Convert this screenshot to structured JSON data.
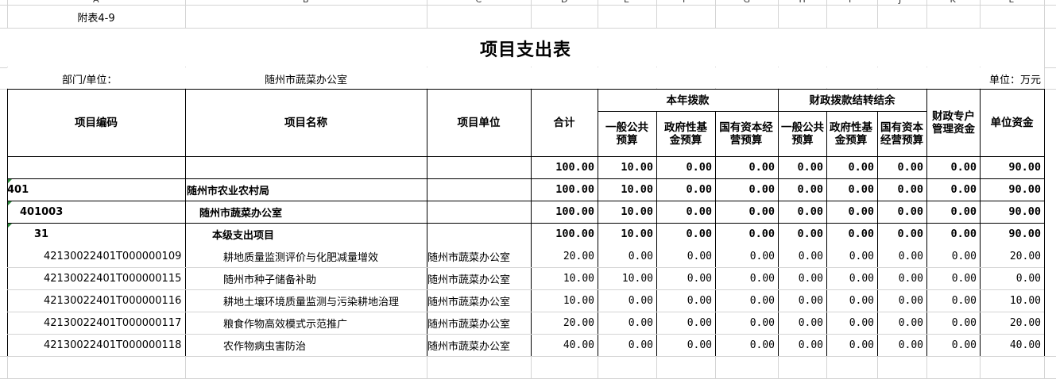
{
  "columns": [
    "A",
    "B",
    "C",
    "D",
    "E",
    "F",
    "G",
    "H",
    "I",
    "J",
    "K",
    "L"
  ],
  "sheet": {
    "attachment": "附表4-9",
    "title": "项目支出表",
    "dept_label": "部门/单位：",
    "dept_value": "随州市蔬菜办公室",
    "unit": "单位：万元"
  },
  "header": {
    "code": "项目编码",
    "name": "项目名称",
    "unit": "项目单位",
    "total": "合计",
    "current_year": "本年拨款",
    "general_budget": "一般公共预算",
    "gov_fund": "政府性基金预算",
    "state_capital": "国有资本经营预算",
    "carryover": "财政拨款结转结余",
    "co_general": "一般公共预算",
    "co_gov_fund": "政府性基金预算",
    "co_state_capital": "国有资本经营预算",
    "special_account": "财政专户管理资金",
    "unit_funds": "单位资金"
  },
  "rows": [
    {
      "level": 0,
      "code": "",
      "name": "",
      "unit": "",
      "values": [
        "100.00",
        "10.00",
        "0.00",
        "0.00",
        "0.00",
        "0.00",
        "0.00",
        "0.00",
        "90.00"
      ]
    },
    {
      "level": 1,
      "code": "401",
      "name": "随州市农业农村局",
      "unit": "",
      "values": [
        "100.00",
        "10.00",
        "0.00",
        "0.00",
        "0.00",
        "0.00",
        "0.00",
        "0.00",
        "90.00"
      ]
    },
    {
      "level": 2,
      "code": "401003",
      "name": "随州市蔬菜办公室",
      "unit": "",
      "values": [
        "100.00",
        "10.00",
        "0.00",
        "0.00",
        "0.00",
        "0.00",
        "0.00",
        "0.00",
        "90.00"
      ]
    },
    {
      "level": 3,
      "code": "31",
      "name": "本级支出项目",
      "unit": "",
      "values": [
        "100.00",
        "10.00",
        "0.00",
        "0.00",
        "0.00",
        "0.00",
        "0.00",
        "0.00",
        "90.00"
      ]
    },
    {
      "level": 4,
      "code": "42130022401T000000109",
      "name": "耕地质量监测评价与化肥减量增效",
      "unit": "随州市蔬菜办公室",
      "values": [
        "20.00",
        "0.00",
        "0.00",
        "0.00",
        "0.00",
        "0.00",
        "0.00",
        "0.00",
        "20.00"
      ]
    },
    {
      "level": 4,
      "code": "42130022401T000000115",
      "name": "随州市种子储备补助",
      "unit": "随州市蔬菜办公室",
      "values": [
        "10.00",
        "10.00",
        "0.00",
        "0.00",
        "0.00",
        "0.00",
        "0.00",
        "0.00",
        "0.00"
      ]
    },
    {
      "level": 4,
      "code": "42130022401T000000116",
      "name": "耕地土壤环境质量监测与污染耕地治理",
      "unit": "随州市蔬菜办公室",
      "values": [
        "10.00",
        "0.00",
        "0.00",
        "0.00",
        "0.00",
        "0.00",
        "0.00",
        "0.00",
        "10.00"
      ]
    },
    {
      "level": 4,
      "code": "42130022401T000000117",
      "name": "粮食作物高效模式示范推广",
      "unit": "随州市蔬菜办公室",
      "values": [
        "20.00",
        "0.00",
        "0.00",
        "0.00",
        "0.00",
        "0.00",
        "0.00",
        "0.00",
        "20.00"
      ]
    },
    {
      "level": 4,
      "code": "42130022401T000000118",
      "name": "农作物病虫害防治",
      "unit": "随州市蔬菜办公室",
      "values": [
        "40.00",
        "0.00",
        "0.00",
        "0.00",
        "0.00",
        "0.00",
        "0.00",
        "0.00",
        "40.00"
      ]
    }
  ]
}
